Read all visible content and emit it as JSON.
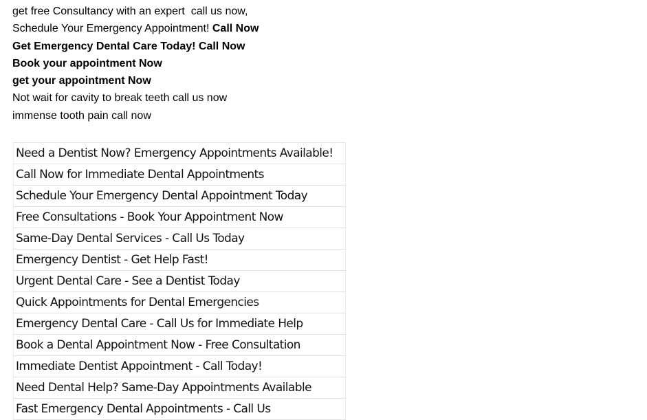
{
  "intro_lines": {
    "line1": "get free Consultancy with an expert  call us now,",
    "line2_regular": "Schedule Your Emergency Appointment! ",
    "line2_bold": "Call Now",
    "line3": "Get Emergency Dental Care Today! Call Now",
    "line4": "Book your appointment Now",
    "line5": "get your appointment Now",
    "line6": "Not wait for cavity to break teeth call us now",
    "line7": "immense tooth pain call now"
  },
  "headline_table": {
    "rows": [
      "Need a Dentist Now? Emergency Appointments Available!",
      "Call Now for Immediate Dental Appointments",
      "Schedule Your Emergency Dental Appointment Today",
      "Free Consultations - Book Your Appointment Now",
      "Same-Day Dental Services - Call Us Today",
      "Emergency Dentist - Get Help Fast!",
      "Urgent Dental Care - See a Dentist Today",
      "Quick Appointments for Dental Emergencies",
      "Emergency Dental Care - Call Us for Immediate Help",
      "Book a Dental Appointment Now - Free Consultation",
      "Immediate Dentist Appointment - Call Today!",
      "Need Dental Help? Same-Day Appointments Available",
      "Fast Emergency Dental Appointments - Call Us"
    ]
  }
}
